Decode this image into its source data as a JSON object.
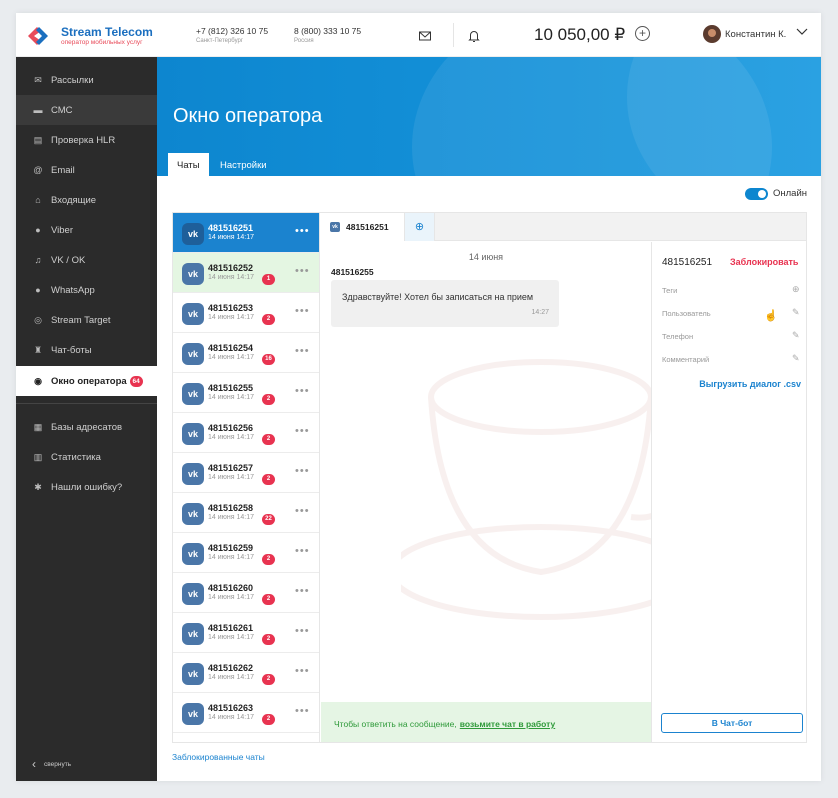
{
  "header": {
    "brand_name": "Stream Telecom",
    "tagline": "оператор мобильных услуг",
    "phone1": {
      "number": "+7 (812) 326 10 75",
      "city": "Санкт-Петербург"
    },
    "phone2": {
      "number": "8 (800) 333 10 75",
      "city": "Россия"
    },
    "balance": "10 050,00 ₽",
    "add_icon": "+",
    "user_name": "Константин К."
  },
  "sidebar": {
    "items": [
      {
        "label": "Рассылки",
        "icon": "mail-icon"
      },
      {
        "label": "СМС",
        "icon": "sms-icon"
      },
      {
        "label": "Проверка HLR",
        "icon": "hlr-icon"
      },
      {
        "label": "Email",
        "icon": "email-icon"
      },
      {
        "label": "Входящие",
        "icon": "inbox-icon"
      },
      {
        "label": "Viber",
        "icon": "viber-icon"
      },
      {
        "label": "VK / OK",
        "icon": "vk-icon"
      },
      {
        "label": "WhatsApp",
        "icon": "whatsapp-icon"
      },
      {
        "label": "Stream Target",
        "icon": "target-icon"
      },
      {
        "label": "Чат-боты",
        "icon": "bot-icon"
      },
      {
        "label": "Окно оператора",
        "icon": "chat-icon",
        "badge": "64"
      },
      {
        "label": "Базы адресатов",
        "icon": "contacts-icon"
      },
      {
        "label": "Статистика",
        "icon": "stats-icon"
      },
      {
        "label": "Нашли ошибку?",
        "icon": "bug-icon"
      }
    ],
    "collapse_label": "свернуть"
  },
  "page": {
    "title": "Окно оператора",
    "tabs": [
      "Чаты",
      "Настройки"
    ],
    "online_label": "Онлайн"
  },
  "chats": [
    {
      "name": "481516251",
      "date": "14 июня 14:17",
      "badge": ""
    },
    {
      "name": "481516252",
      "date": "14 июня 14:17",
      "badge": "1"
    },
    {
      "name": "481516253",
      "date": "14 июня 14:17",
      "badge": "2"
    },
    {
      "name": "481516254",
      "date": "14 июня 14:17",
      "badge": "16"
    },
    {
      "name": "481516255",
      "date": "14 июня 14:17",
      "badge": "2"
    },
    {
      "name": "481516256",
      "date": "14 июня 14:17",
      "badge": "2"
    },
    {
      "name": "481516257",
      "date": "14 июня 14:17",
      "badge": "2"
    },
    {
      "name": "481516258",
      "date": "14 июня 14:17",
      "badge": "22"
    },
    {
      "name": "481516259",
      "date": "14 июня 14:17",
      "badge": "2"
    },
    {
      "name": "481516260",
      "date": "14 июня 14:17",
      "badge": "2"
    },
    {
      "name": "481516261",
      "date": "14 июня 14:17",
      "badge": "2"
    },
    {
      "name": "481516262",
      "date": "14 июня 14:17",
      "badge": "2"
    },
    {
      "name": "481516263",
      "date": "14 июня 14:17",
      "badge": "2"
    }
  ],
  "chat_window": {
    "open_tab": "481516251",
    "date_divider": "14 июня",
    "sender": "481516255",
    "message": "Здравствуйте! Хотел бы записаться на прием",
    "time": "14:27",
    "take_prefix": "Чтобы ответить на сообщение,",
    "take_link": "возьмите чат в работу"
  },
  "info_panel": {
    "name": "481516251",
    "block_label": "Заблокировать",
    "fields": [
      "Теги",
      "Пользователь",
      "Телефон",
      "Комментарий"
    ],
    "export_label": "Выгрузить диалог .csv",
    "bot_button": "В Чат-бот"
  },
  "footer": {
    "blocked_link": "Заблокированные чаты"
  }
}
